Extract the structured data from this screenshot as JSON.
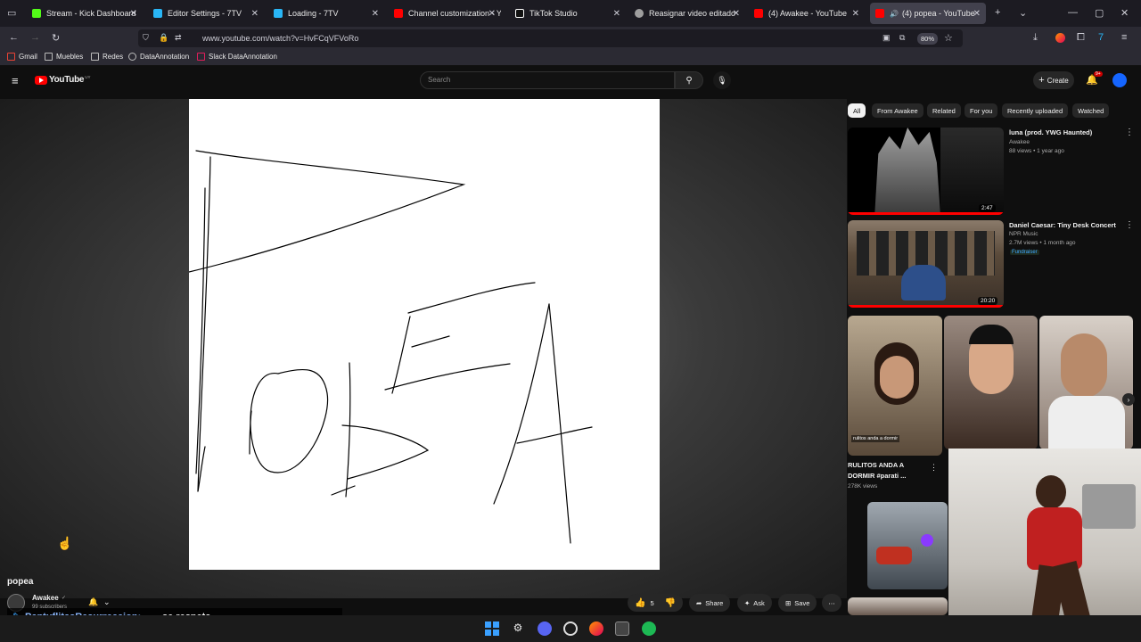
{
  "browser": {
    "tabs": [
      {
        "title": "Stream - Kick Dashboard",
        "color": "#53fc18"
      },
      {
        "title": "Editor Settings - 7TV",
        "color": "#29b6f6"
      },
      {
        "title": "Loading - 7TV",
        "color": "#29b6f6"
      },
      {
        "title": "Channel customization - Yo",
        "color": "#ff0000"
      },
      {
        "title": "TikTok Studio",
        "color": "#111111"
      },
      {
        "title": "Reasignar video editado",
        "color": "#9e9e9e"
      },
      {
        "title": "(4) Awakee - YouTube",
        "color": "#ff0000"
      },
      {
        "title": "(4) popea - YouTube",
        "color": "#ff0000"
      }
    ],
    "url": "www.youtube.com/watch?v=HvFCqVFVoRo",
    "zoom": "80%",
    "bookmarks": [
      "Gmail",
      "Muebles",
      "Redes",
      "DataAnnotation",
      "Slack DataAnnotation"
    ]
  },
  "youtube": {
    "logo_text": "YouTube",
    "logo_country": "UY",
    "search_placeholder": "Search",
    "create_label": "Create",
    "notif_count": "9+",
    "chips": [
      "All",
      "From Awakee",
      "Related",
      "For you",
      "Recently uploaded",
      "Watched"
    ],
    "recommendations": [
      {
        "title": "luna (prod. YWG Haunted)",
        "channel": "Awakee",
        "stats": "88 views • 1 year ago",
        "duration": "2:47"
      },
      {
        "title": "Daniel Caesar: Tiny Desk Concert",
        "channel": "NPR Music",
        "stats": "2.7M views • 1 month ago",
        "duration": "20:20",
        "badge": "Fundraiser"
      }
    ],
    "shorts": [
      {
        "title_line1": "RULITOS ANDA A",
        "title_line2": "DORMIR #parati ...",
        "views": "278K views",
        "caption": "rulitos anda a dormir"
      }
    ],
    "video": {
      "title": "popea",
      "channel": "Awakee",
      "subscribers": "99 subscribers",
      "likes": "5",
      "share_label": "Share",
      "ask_label": "Ask",
      "save_label": "Save"
    }
  },
  "chat_overlay": {
    "user": "PantuflitasResurreccion:",
    "message": "se respeta"
  }
}
